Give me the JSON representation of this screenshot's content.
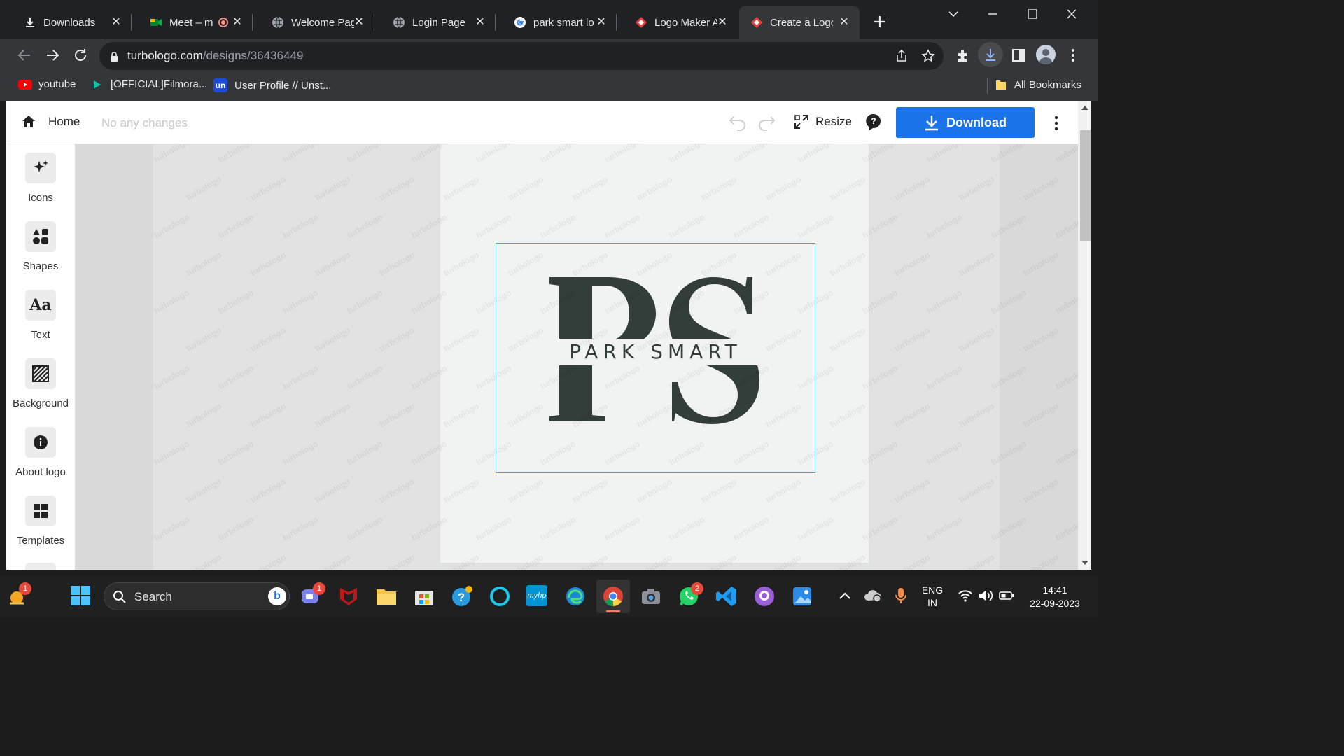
{
  "browser": {
    "tabs": [
      {
        "title": "Downloads",
        "icon": "download-icon"
      },
      {
        "title": "Meet – m",
        "icon": "google-meet-icon"
      },
      {
        "title": "Welcome Pag",
        "icon": "globe-icon"
      },
      {
        "title": "Login Page",
        "icon": "globe-icon"
      },
      {
        "title": "park smart lo",
        "icon": "google-icon"
      },
      {
        "title": "Logo Maker A",
        "icon": "turbologo-icon"
      },
      {
        "title": "Create a Logo",
        "icon": "turbologo-icon"
      }
    ],
    "url_host": "turbologo.com",
    "url_path": "/designs/36436449",
    "bookmarks": [
      {
        "label": "youtube"
      },
      {
        "label": "[OFFICIAL]Filmora..."
      },
      {
        "label": "User Profile // Unst..."
      }
    ],
    "all_bookmarks": "All Bookmarks"
  },
  "app": {
    "home_label": "Home",
    "status": "No any changes",
    "resize_label": "Resize",
    "download_label": "Download",
    "accent": "#1a73e8",
    "sidebar": [
      {
        "label": "Icons",
        "icon": "sparkle-icon"
      },
      {
        "label": "Shapes",
        "icon": "shapes-icon"
      },
      {
        "label": "Text",
        "icon": "text-icon"
      },
      {
        "label": "Background",
        "icon": "background-icon"
      },
      {
        "label": "About logo",
        "icon": "info-icon"
      },
      {
        "label": "Templates",
        "icon": "templates-icon"
      }
    ],
    "logo": {
      "monogram": "PS",
      "name": "PARK SMART",
      "color": "#333d3a"
    },
    "watermark": "turbologo"
  },
  "taskbar": {
    "search_placeholder": "Search",
    "lang": "ENG",
    "region": "IN",
    "time": "14:41",
    "date": "22-09-2023",
    "badges": {
      "weather": "1",
      "chat": "1",
      "whatsapp": "2"
    }
  }
}
